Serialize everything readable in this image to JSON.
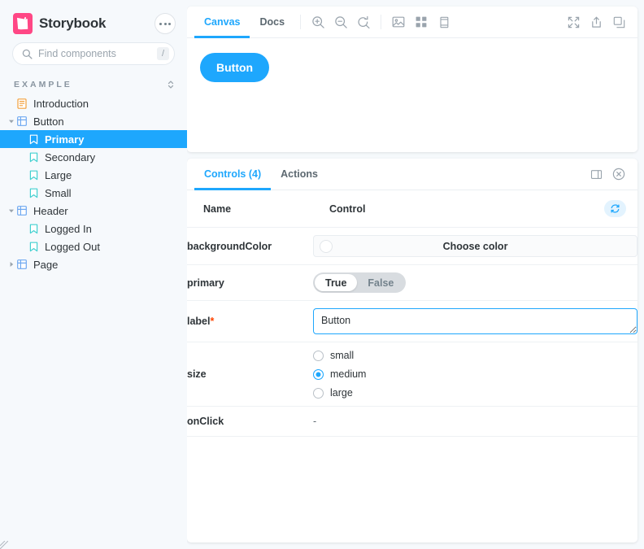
{
  "sidebar": {
    "brand": {
      "name": "Storybook",
      "logo_icon": "storybook-logo-icon"
    },
    "menu_button": {
      "icon": "ellipsis-icon"
    },
    "search": {
      "placeholder": "Find components",
      "value": "",
      "shortcut": "/",
      "icon": "search-icon"
    },
    "section": {
      "title": "EXAMPLE",
      "sort_icon": "sort-chevrons-icon"
    },
    "tree": [
      {
        "label": "Introduction",
        "level": 0,
        "icon": "document-icon",
        "twisty": "",
        "selected": false
      },
      {
        "label": "Button",
        "level": 0,
        "icon": "component-grid-icon",
        "twisty": "down",
        "selected": false
      },
      {
        "label": "Primary",
        "level": 1,
        "icon": "story-bookmark-icon",
        "twisty": "",
        "selected": true
      },
      {
        "label": "Secondary",
        "level": 1,
        "icon": "story-bookmark-icon",
        "twisty": "",
        "selected": false
      },
      {
        "label": "Large",
        "level": 1,
        "icon": "story-bookmark-icon",
        "twisty": "",
        "selected": false
      },
      {
        "label": "Small",
        "level": 1,
        "icon": "story-bookmark-icon",
        "twisty": "",
        "selected": false
      },
      {
        "label": "Header",
        "level": 0,
        "icon": "component-grid-icon",
        "twisty": "down",
        "selected": false
      },
      {
        "label": "Logged In",
        "level": 1,
        "icon": "story-bookmark-icon",
        "twisty": "",
        "selected": false
      },
      {
        "label": "Logged Out",
        "level": 1,
        "icon": "story-bookmark-icon",
        "twisty": "",
        "selected": false
      },
      {
        "label": "Page",
        "level": 0,
        "icon": "component-grid-icon",
        "twisty": "right",
        "selected": false
      }
    ]
  },
  "canvas": {
    "tabs": [
      {
        "label": "Canvas",
        "active": true
      },
      {
        "label": "Docs",
        "active": false
      }
    ],
    "tools": [
      {
        "icon": "zoom-in-icon"
      },
      {
        "icon": "zoom-out-icon"
      },
      {
        "icon": "zoom-reset-icon"
      },
      {
        "icon": "background-image-icon"
      },
      {
        "icon": "grid-icon"
      },
      {
        "icon": "measure-icon"
      }
    ],
    "right_tools": [
      {
        "icon": "fullscreen-icon"
      },
      {
        "icon": "share-open-new-tab-icon"
      },
      {
        "icon": "copy-icon"
      }
    ],
    "preview": {
      "button_label": "Button"
    }
  },
  "addons": {
    "tabs": [
      {
        "label": "Controls (4)",
        "active": true
      },
      {
        "label": "Actions",
        "active": false
      }
    ],
    "right_tools": [
      {
        "icon": "panel-position-icon"
      },
      {
        "icon": "close-circle-icon"
      }
    ],
    "table": {
      "headers": {
        "name": "Name",
        "control": "Control"
      },
      "reset_button": {
        "icon": "refresh-icon"
      },
      "rows": [
        {
          "name": "backgroundColor",
          "required": false,
          "type": "color",
          "placeholder": "Choose color",
          "swatch": "#ffffff"
        },
        {
          "name": "primary",
          "required": false,
          "type": "boolean",
          "options": [
            "True",
            "False"
          ],
          "value": "True"
        },
        {
          "name": "label",
          "required": true,
          "type": "text",
          "value": "Button",
          "focused": true
        },
        {
          "name": "size",
          "required": false,
          "type": "radio",
          "options": [
            "small",
            "medium",
            "large"
          ],
          "value": "medium"
        },
        {
          "name": "onClick",
          "required": false,
          "type": "empty",
          "value": "-"
        }
      ]
    }
  },
  "colors": {
    "accent": "#1ea7fd",
    "brand": "#ff4785",
    "required": "#ff4400",
    "background": "#f6f9fc",
    "text": "#2e3438"
  }
}
